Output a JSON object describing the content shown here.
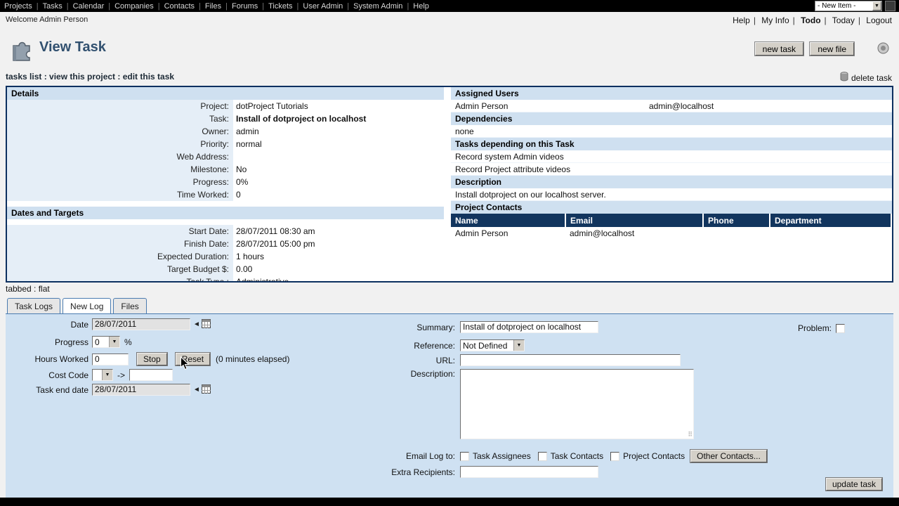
{
  "colors": {
    "navy": "#0c3060",
    "section_blue": "#cfe0f0",
    "panel_blue": "#cfe1f2",
    "table_header": "#12355e"
  },
  "menubar": {
    "items": [
      "Projects",
      "Tasks",
      "Calendar",
      "Companies",
      "Contacts",
      "Files",
      "Forums",
      "Tickets",
      "User Admin",
      "System Admin",
      "Help"
    ],
    "new_item_label": "- New Item -"
  },
  "topbar": {
    "welcome": "Welcome Admin Person",
    "links": [
      "Help",
      "My Info",
      "Todo",
      "Today",
      "Logout"
    ]
  },
  "header": {
    "title": "View Task",
    "new_task": "new task",
    "new_file": "new file"
  },
  "crumbs": {
    "path": "tasks list : view this project : edit this task",
    "delete_label": "delete task"
  },
  "details": {
    "title": "Details",
    "rows": [
      {
        "label": "Project:",
        "value": "dotProject Tutorials"
      },
      {
        "label": "Task:",
        "value": "Install of dotproject on localhost"
      },
      {
        "label": "Owner:",
        "value": "admin"
      },
      {
        "label": "Priority:",
        "value": "normal"
      },
      {
        "label": "Web Address:",
        "value": ""
      },
      {
        "label": "Milestone:",
        "value": "No"
      },
      {
        "label": "Progress:",
        "value": "0%"
      },
      {
        "label": "Time Worked:",
        "value": "0"
      }
    ]
  },
  "dates": {
    "title": "Dates and Targets",
    "rows": [
      {
        "label": "Start Date:",
        "value": "28/07/2011 08:30 am"
      },
      {
        "label": "Finish Date:",
        "value": "28/07/2011 05:00 pm"
      },
      {
        "label": "Expected Duration:",
        "value": "1 hours"
      },
      {
        "label": "Target Budget $:",
        "value": "0.00"
      },
      {
        "label": "Task Type :",
        "value": "Administrative"
      }
    ]
  },
  "right": {
    "assigned_title": "Assigned Users",
    "assigned": [
      {
        "name": "Admin Person",
        "email": "admin@localhost"
      }
    ],
    "dependencies_title": "Dependencies",
    "dependencies_value": "none",
    "depending_title": "Tasks depending on this Task",
    "depending": [
      "Record system Admin videos",
      "Record Project attribute videos"
    ],
    "description_title": "Description",
    "description_value": "Install dotproject on our localhost server.",
    "contacts_title": "Project Contacts",
    "contacts": {
      "headers": [
        "Name",
        "Email",
        "Phone",
        "Department"
      ],
      "rows": [
        {
          "name": "Admin Person",
          "email": "admin@localhost",
          "phone": "",
          "department": ""
        }
      ]
    }
  },
  "tabs": {
    "mode": "tabbed : flat",
    "items": [
      "Task Logs",
      "New Log",
      "Files"
    ],
    "active": "New Log"
  },
  "form": {
    "date_label": "Date",
    "date_value": "28/07/2011",
    "progress_label": "Progress",
    "progress_value": "0",
    "percent": "%",
    "hours_label": "Hours Worked",
    "hours_value": "0",
    "stop_label": "Stop",
    "reset_label": "Reset",
    "elapsed": "(0 minutes elapsed)",
    "cost_label": "Cost Code",
    "arrow": "->",
    "end_label": "Task end date",
    "end_value": "28/07/2011",
    "summary_label": "Summary:",
    "summary_value": "Install of dotproject on localhost",
    "reference_label": "Reference:",
    "reference_value": "Not Defined",
    "url_label": "URL:",
    "url_value": "",
    "description_label": "Description:",
    "description_value": "",
    "email_log_label": "Email Log to:",
    "cb_assignees": "Task Assignees",
    "cb_contacts": "Task Contacts",
    "cb_project_contacts": "Project Contacts",
    "other_contacts": "Other Contacts...",
    "extra_label": "Extra Recipients:",
    "extra_value": "",
    "problem_label": "Problem:",
    "update_label": "update task"
  }
}
